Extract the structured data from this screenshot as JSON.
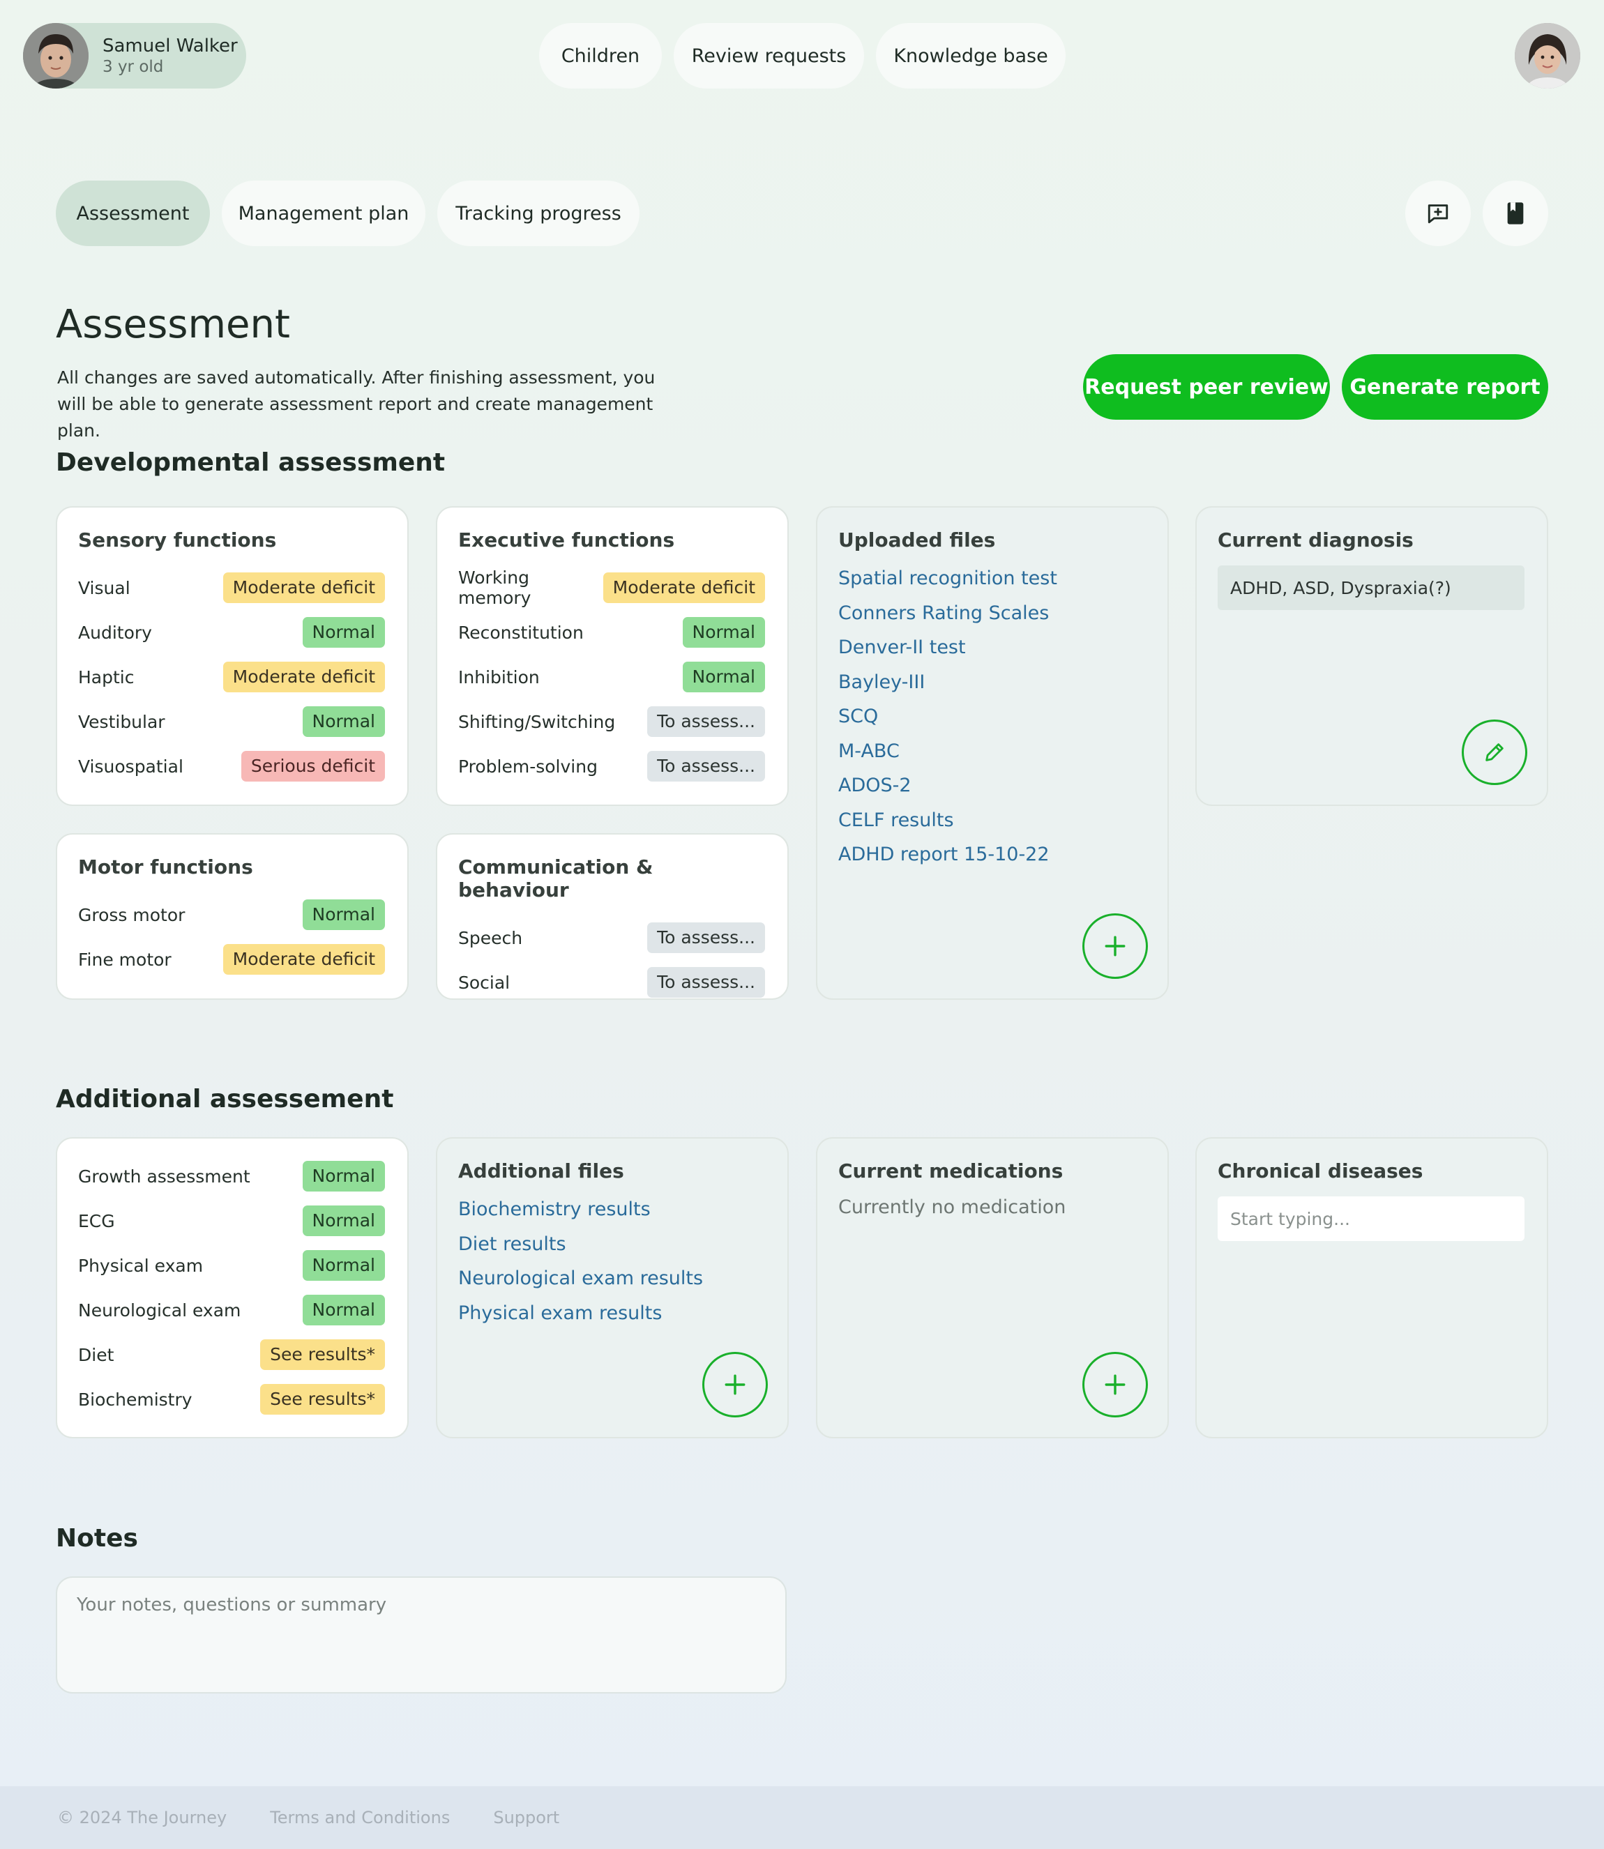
{
  "patient": {
    "name": "Samuel Walker",
    "age": "3 yr old"
  },
  "top_nav": [
    "Children",
    "Review requests",
    "Knowledge base"
  ],
  "tabs": [
    "Assessment",
    "Management plan",
    "Tracking progress"
  ],
  "header": {
    "title": "Assessment",
    "description": "All changes are saved automatically. After finishing assessment, you will be able to generate assessment report and create management plan.",
    "peer_review_label": "Request peer review",
    "generate_report_label": "Generate report"
  },
  "colors": {
    "accent": "#0fbd1f",
    "moderate_deficit": "#fbe08a",
    "normal": "#90dd97",
    "serious_deficit": "#f7b8b6",
    "to_assess": "#dfe5e8",
    "link": "#2a6b9a"
  },
  "developmental": {
    "title": "Developmental assessment",
    "sensory": {
      "title": "Sensory functions",
      "rows": [
        {
          "label": "Visual",
          "status": "Moderate deficit"
        },
        {
          "label": "Auditory",
          "status": "Normal"
        },
        {
          "label": "Haptic",
          "status": "Moderate deficit"
        },
        {
          "label": "Vestibular",
          "status": "Normal"
        },
        {
          "label": "Visuospatial",
          "status": "Serious deficit"
        }
      ]
    },
    "executive": {
      "title": "Executive functions",
      "rows": [
        {
          "label": "Working memory",
          "status": "Moderate deficit"
        },
        {
          "label": "Reconstitution",
          "status": "Normal"
        },
        {
          "label": "Inhibition",
          "status": "Normal"
        },
        {
          "label": "Shifting/Switching",
          "status": "To assess..."
        },
        {
          "label": "Problem-solving",
          "status": "To assess..."
        }
      ]
    },
    "motor": {
      "title": "Motor functions",
      "rows": [
        {
          "label": "Gross motor",
          "status": "Normal"
        },
        {
          "label": "Fine motor",
          "status": "Moderate deficit"
        }
      ]
    },
    "communication": {
      "title": "Communication & behaviour",
      "rows": [
        {
          "label": "Speech",
          "status": "To assess..."
        },
        {
          "label": "Social",
          "status": "To assess..."
        }
      ]
    },
    "uploaded_files": {
      "title": "Uploaded files",
      "files": [
        "Spatial recognition test",
        "Conners Rating Scales",
        "Denver-II test",
        "Bayley-III",
        "SCQ",
        "M-ABC",
        "ADOS-2",
        "CELF results",
        "ADHD report 15-10-22"
      ]
    },
    "diagnosis": {
      "title": "Current diagnosis",
      "value": "ADHD, ASD, Dyspraxia(?)"
    }
  },
  "additional": {
    "title": "Additional assessement",
    "checks": {
      "rows": [
        {
          "label": "Growth assessment",
          "status": "Normal"
        },
        {
          "label": "ECG",
          "status": "Normal"
        },
        {
          "label": "Physical exam",
          "status": "Normal"
        },
        {
          "label": "Neurological exam",
          "status": "Normal"
        },
        {
          "label": "Diet",
          "status": "See results*"
        },
        {
          "label": "Biochemistry",
          "status": "See results*"
        }
      ]
    },
    "files": {
      "title": "Additional files",
      "files": [
        "Biochemistry results",
        "Diet results",
        "Neurological exam results",
        "Physical exam results"
      ]
    },
    "medications": {
      "title": "Current medications",
      "empty_text": "Currently no medication"
    },
    "chronic": {
      "title": "Chronical diseases",
      "placeholder": "Start typing..."
    }
  },
  "notes": {
    "title": "Notes",
    "placeholder": "Your notes, questions or summary"
  },
  "footer": {
    "copyright": "© 2024 The Journey",
    "terms": "Terms and Conditions",
    "support": "Support"
  }
}
